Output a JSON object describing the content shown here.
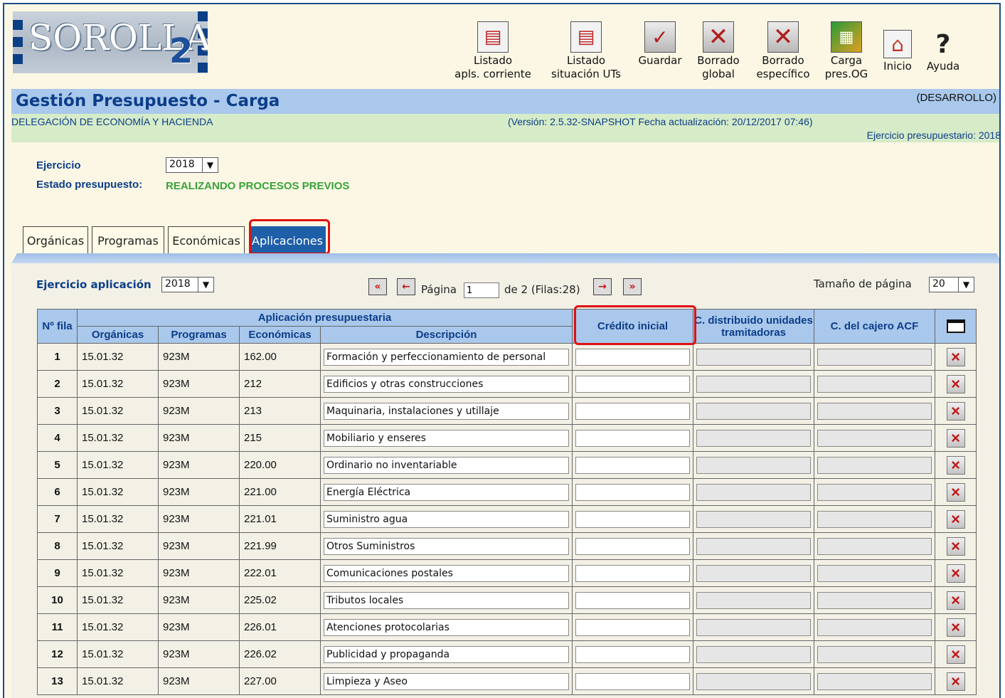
{
  "app": {
    "logo_text": "SOROLLA",
    "logo_suffix": "2"
  },
  "toolbar": {
    "items": [
      {
        "line1": "Listado",
        "line2": "apls. corriente"
      },
      {
        "line1": "Listado",
        "line2": "situación UTs"
      },
      {
        "line1": "Guardar",
        "line2": ""
      },
      {
        "line1": "Borrado",
        "line2": "global"
      },
      {
        "line1": "Borrado",
        "line2": "específico"
      },
      {
        "line1": "Carga",
        "line2": "pres.OG"
      },
      {
        "line1": "Inicio",
        "line2": ""
      },
      {
        "line1": "Ayuda",
        "line2": ""
      }
    ]
  },
  "header": {
    "title": "Gestión Presupuesto - Carga",
    "environment": "(DESARROLLO)",
    "department": "DELEGACIÓN DE ECONOMÍA Y HACIENDA",
    "version": "(Versión: 2.5.32-SNAPSHOT Fecha actualización: 20/12/2017 07:46)",
    "exercise": "Ejercicio presupuestario: 2018"
  },
  "filters": {
    "ejercicio_label": "Ejercicio",
    "ejercicio_value": "2018",
    "estado_label": "Estado presupuesto:",
    "estado_value": "REALIZANDO PROCESOS PREVIOS"
  },
  "tabs": [
    {
      "label": "Orgánicas",
      "active": false
    },
    {
      "label": "Programas",
      "active": false
    },
    {
      "label": "Económicas",
      "active": false
    },
    {
      "label": "Aplicaciones",
      "active": true
    }
  ],
  "pager": {
    "ejercicio_aplicacion_label": "Ejercicio aplicación",
    "ejercicio_aplicacion_value": "2018",
    "pagina_label": "Página",
    "pagina_value": "1",
    "of_text": "de 2 (Filas:28)",
    "page_size_label": "Tamaño de página",
    "page_size_value": "20"
  },
  "table": {
    "headers": {
      "row_no": "Nº fila",
      "group": "Aplicación presupuestaria",
      "organicas": "Orgánicas",
      "programas": "Programas",
      "economicas": "Económicas",
      "descripcion": "Descripción",
      "credito": "Crédito inicial",
      "distribuido": "C. distribuido unidades tramitadoras",
      "cajero": "C. del cajero ACF"
    },
    "rows": [
      {
        "n": "1",
        "org": "15.01.32",
        "prog": "923M",
        "eco": "162.00",
        "desc": "Formación y perfeccionamiento de personal"
      },
      {
        "n": "2",
        "org": "15.01.32",
        "prog": "923M",
        "eco": "212",
        "desc": "Edificios y otras construcciones"
      },
      {
        "n": "3",
        "org": "15.01.32",
        "prog": "923M",
        "eco": "213",
        "desc": "Maquinaria, instalaciones y utillaje"
      },
      {
        "n": "4",
        "org": "15.01.32",
        "prog": "923M",
        "eco": "215",
        "desc": "Mobiliario y enseres"
      },
      {
        "n": "5",
        "org": "15.01.32",
        "prog": "923M",
        "eco": "220.00",
        "desc": "Ordinario no inventariable"
      },
      {
        "n": "6",
        "org": "15.01.32",
        "prog": "923M",
        "eco": "221.00",
        "desc": "Energía Eléctrica"
      },
      {
        "n": "7",
        "org": "15.01.32",
        "prog": "923M",
        "eco": "221.01",
        "desc": "Suministro agua"
      },
      {
        "n": "8",
        "org": "15.01.32",
        "prog": "923M",
        "eco": "221.99",
        "desc": "Otros Suministros"
      },
      {
        "n": "9",
        "org": "15.01.32",
        "prog": "923M",
        "eco": "222.01",
        "desc": "Comunicaciones postales"
      },
      {
        "n": "10",
        "org": "15.01.32",
        "prog": "923M",
        "eco": "225.02",
        "desc": "Tributos locales"
      },
      {
        "n": "11",
        "org": "15.01.32",
        "prog": "923M",
        "eco": "226.01",
        "desc": "Atenciones protocolarias"
      },
      {
        "n": "12",
        "org": "15.01.32",
        "prog": "923M",
        "eco": "226.02",
        "desc": "Publicidad y propaganda"
      },
      {
        "n": "13",
        "org": "15.01.32",
        "prog": "923M",
        "eco": "227.00",
        "desc": "Limpieza y Aseo"
      }
    ]
  }
}
